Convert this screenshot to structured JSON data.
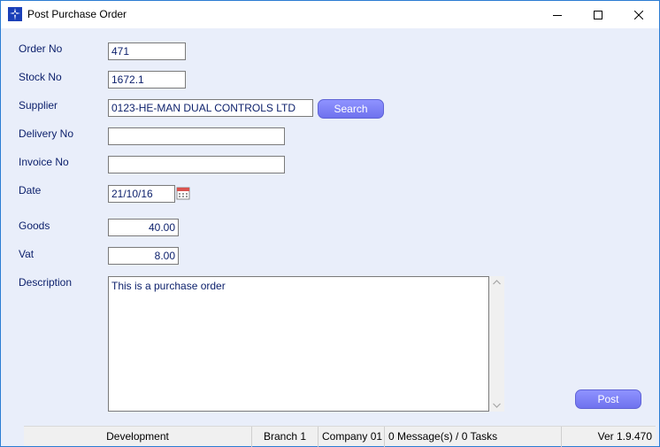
{
  "window": {
    "title": "Post Purchase Order",
    "accent": "#2b7cd3"
  },
  "form": {
    "order_no": {
      "label": "Order No",
      "value": "471"
    },
    "stock_no": {
      "label": "Stock No",
      "value": "1672.1"
    },
    "supplier": {
      "label": "Supplier",
      "value": "0123-HE-MAN DUAL CONTROLS LTD",
      "search_label": "Search"
    },
    "delivery_no": {
      "label": "Delivery No",
      "value": ""
    },
    "invoice_no": {
      "label": "Invoice No",
      "value": ""
    },
    "date": {
      "label": "Date",
      "value": "21/10/16"
    },
    "goods": {
      "label": "Goods",
      "value": "40.00"
    },
    "vat": {
      "label": "Vat",
      "value": "8.00"
    },
    "description": {
      "label": "Description",
      "value": "This is a purchase order"
    },
    "post_label": "Post",
    "button_color": "#7b7ff5"
  },
  "statusbar": {
    "environment": "Development",
    "branch": "Branch 1",
    "company": "Company 01",
    "messages": "0 Message(s) / 0 Tasks",
    "version": "Ver 1.9.470"
  }
}
